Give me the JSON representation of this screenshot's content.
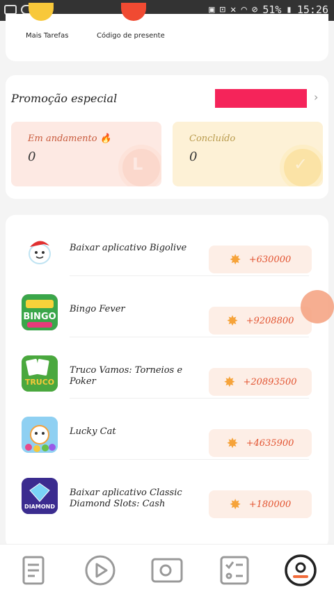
{
  "status_bar": {
    "battery": "51%",
    "time": "15:26"
  },
  "top_menu": {
    "items": [
      {
        "label": "Mais Tarefas",
        "color": "#f8c83a"
      },
      {
        "label": "Código de presente",
        "color": "#f04a32"
      }
    ]
  },
  "promo": {
    "title": "Promoção especial",
    "banner_color": "#f5245a",
    "in_progress": {
      "label": "Em andamento",
      "value": "0"
    },
    "completed": {
      "label": "Concluído",
      "value": "0"
    }
  },
  "tasks": [
    {
      "name": "Baixar aplicativo Bigolive",
      "reward": "+630000"
    },
    {
      "name": "Bingo Fever",
      "reward": "+9208800"
    },
    {
      "name": "Truco Vamos: Torneios e Poker",
      "reward": "+20893500"
    },
    {
      "name": "Lucky Cat",
      "reward": "+4635900"
    },
    {
      "name": "Baixar aplicativo Classic Diamond Slots: Cash",
      "reward": "+180000"
    }
  ],
  "nav": {
    "items": [
      "tasks-doc-icon",
      "play-icon",
      "camera-icon",
      "checklist-icon",
      "profile-icon"
    ],
    "active": "profile-icon"
  }
}
